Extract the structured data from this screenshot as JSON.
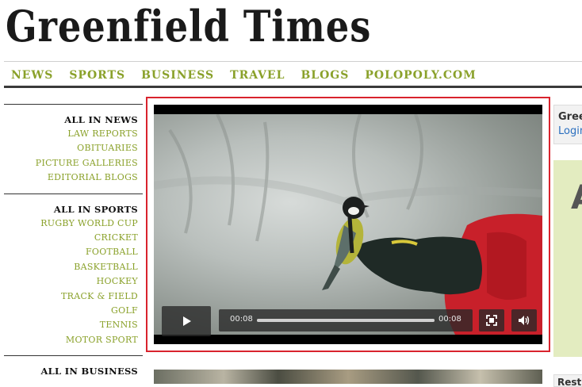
{
  "site": {
    "title": "Greenfield Times"
  },
  "nav": {
    "items": [
      "NEWS",
      "SPORTS",
      "BUSINESS",
      "TRAVEL",
      "BLOGS",
      "POLOPOLY.COM"
    ]
  },
  "sidebar": {
    "sections": [
      {
        "heading": "ALL IN NEWS",
        "links": [
          "LAW REPORTS",
          "OBITUARIES",
          "PICTURE GALLERIES",
          "EDITORIAL BLOGS"
        ]
      },
      {
        "heading": "ALL IN SPORTS",
        "links": [
          "RUGBY WORLD CUP",
          "CRICKET",
          "FOOTBALL",
          "BASKETBALL",
          "HOCKEY",
          "TRACK & FIELD",
          "GOLF",
          "TENNIS",
          "MOTOR SPORT"
        ]
      },
      {
        "heading": "ALL IN BUSINESS",
        "links": []
      }
    ]
  },
  "video": {
    "current_time": "00:08",
    "duration": "00:08",
    "progress": 1.0,
    "play_icon": "play-icon",
    "fullscreen_icon": "fullscreen-icon",
    "volume_icon": "volume-icon"
  },
  "right_panel": {
    "title": "Gree",
    "login": "Login",
    "ad_letter": "A",
    "bottom_title": "Rest"
  },
  "colors": {
    "nav_link": "#8aa12a",
    "frame_border": "#d9232d",
    "ad_bg": "#e3ecc0"
  }
}
